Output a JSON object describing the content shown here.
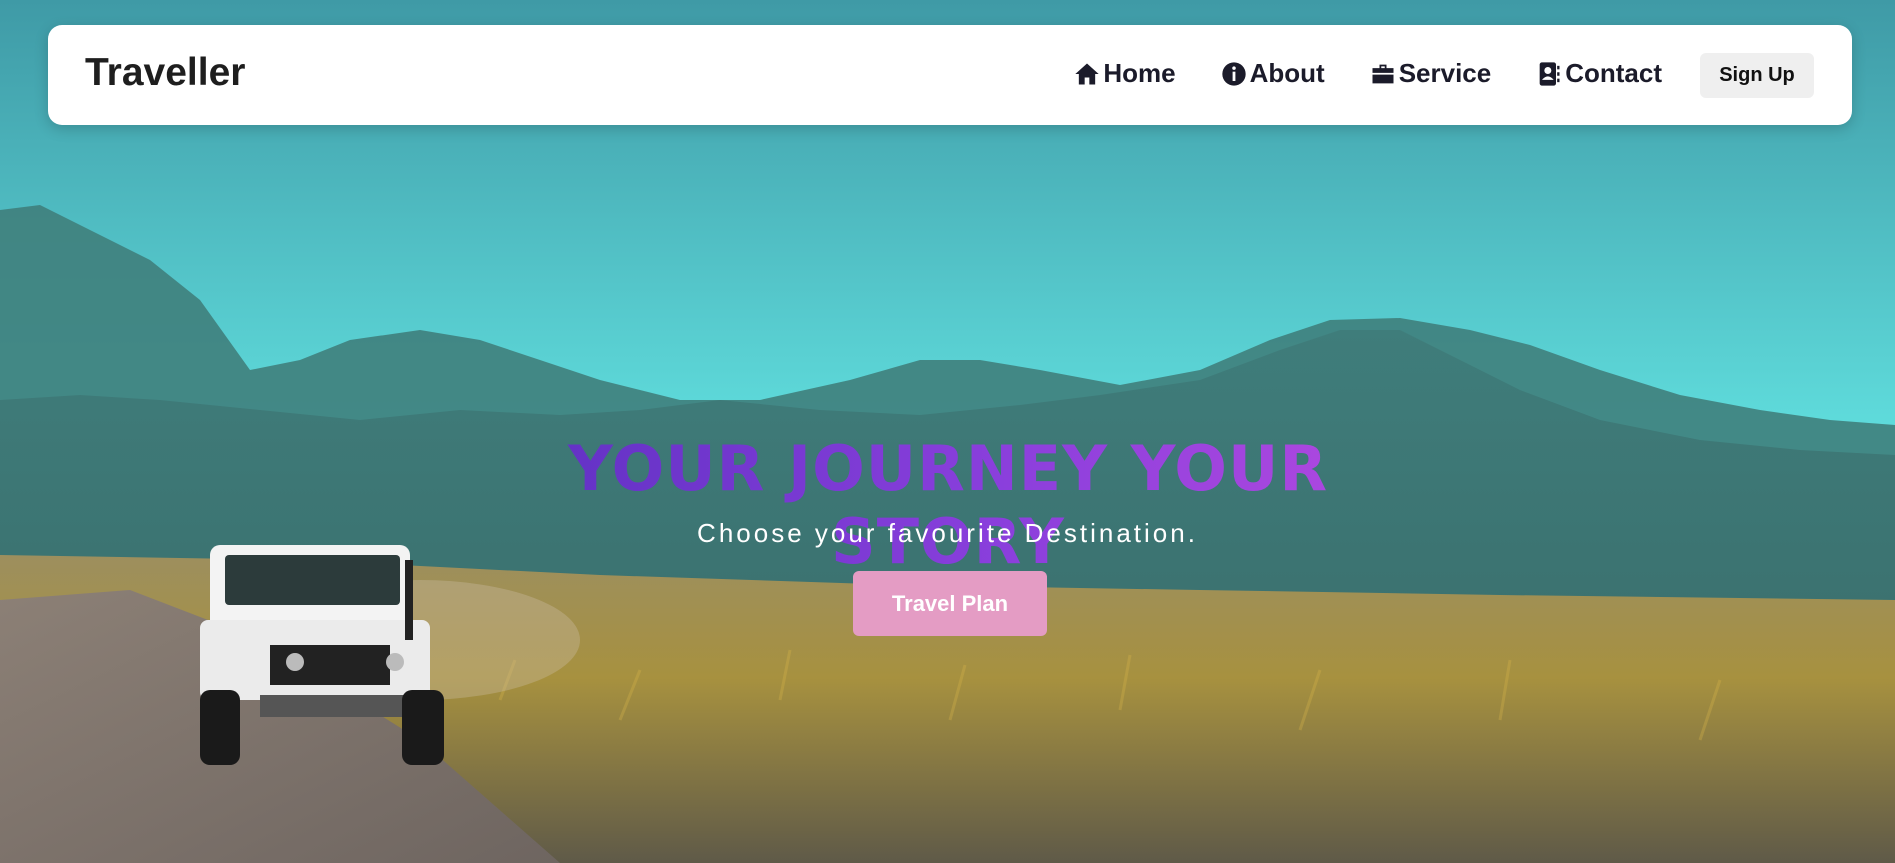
{
  "navbar": {
    "brand": "Traveller",
    "links": [
      {
        "label": "Home",
        "icon": "home-icon"
      },
      {
        "label": "About",
        "icon": "info-icon"
      },
      {
        "label": "Service",
        "icon": "briefcase-icon"
      },
      {
        "label": "Contact",
        "icon": "contact-book-icon"
      }
    ],
    "signup_label": "Sign Up"
  },
  "hero": {
    "headline": "YOUR JOURNEY YOUR STORY",
    "subheadline": "Choose your favourite Destination.",
    "cta_label": "Travel Plan",
    "background_image": "landscape with mountains, grassland and white jeep on dirt road"
  },
  "colors": {
    "headline_gradient_start": "#5a2fc0",
    "headline_gradient_end": "#b64ae0",
    "cta_background": "#e49cc4",
    "navbar_background": "#ffffff",
    "sky": "#5fdcdc"
  }
}
